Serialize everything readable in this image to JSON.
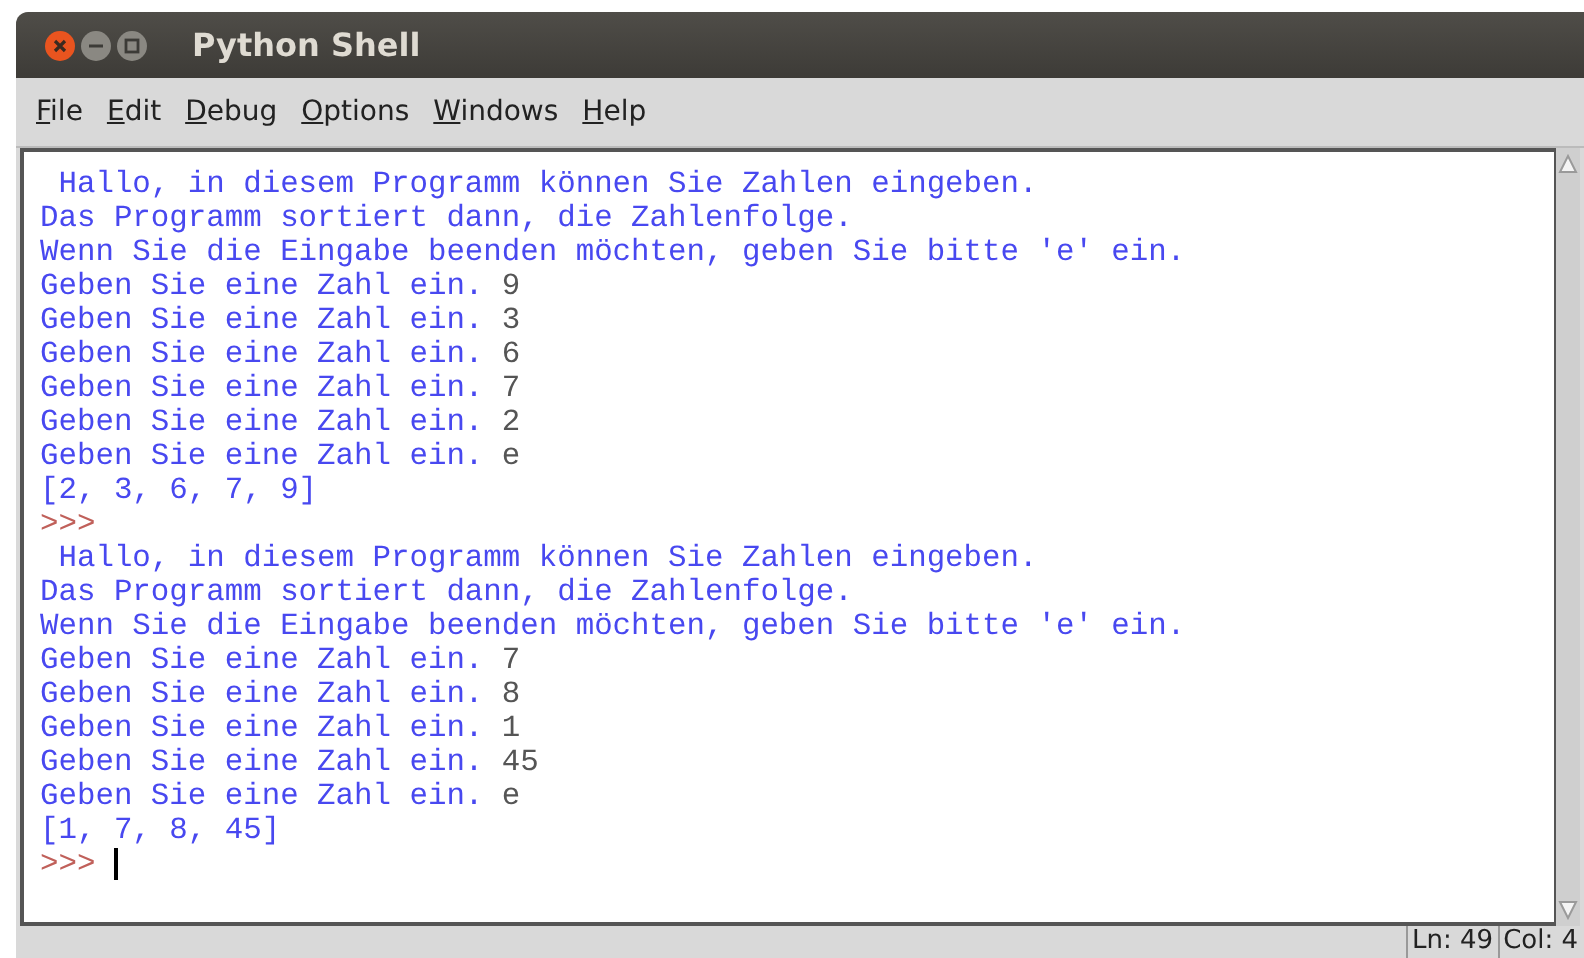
{
  "window": {
    "title": "Python Shell"
  },
  "menu": [
    {
      "label": "File"
    },
    {
      "label": "Edit"
    },
    {
      "label": "Debug"
    },
    {
      "label": "Options"
    },
    {
      "label": "Windows"
    },
    {
      "label": "Help"
    }
  ],
  "shell_lines": [
    {
      "kind": "output",
      "text": " Hallo, in diesem Programm können Sie Zahlen eingeben."
    },
    {
      "kind": "output",
      "text": "Das Programm sortiert dann, die Zahlenfolge."
    },
    {
      "kind": "output",
      "text": "Wenn Sie die Eingabe beenden möchten, geben Sie bitte 'e' ein."
    },
    {
      "kind": "input",
      "prompt": "Geben Sie eine Zahl ein.",
      "value": "9"
    },
    {
      "kind": "input",
      "prompt": "Geben Sie eine Zahl ein.",
      "value": "3"
    },
    {
      "kind": "input",
      "prompt": "Geben Sie eine Zahl ein.",
      "value": "6"
    },
    {
      "kind": "input",
      "prompt": "Geben Sie eine Zahl ein.",
      "value": "7"
    },
    {
      "kind": "input",
      "prompt": "Geben Sie eine Zahl ein.",
      "value": "2"
    },
    {
      "kind": "input",
      "prompt": "Geben Sie eine Zahl ein.",
      "value": "e"
    },
    {
      "kind": "output",
      "text": "[2, 3, 6, 7, 9]"
    },
    {
      "kind": "prompt",
      "text": ">>>",
      "cursor": false
    },
    {
      "kind": "output",
      "text": " Hallo, in diesem Programm können Sie Zahlen eingeben."
    },
    {
      "kind": "output",
      "text": "Das Programm sortiert dann, die Zahlenfolge."
    },
    {
      "kind": "output",
      "text": "Wenn Sie die Eingabe beenden möchten, geben Sie bitte 'e' ein."
    },
    {
      "kind": "input",
      "prompt": "Geben Sie eine Zahl ein.",
      "value": "7"
    },
    {
      "kind": "input",
      "prompt": "Geben Sie eine Zahl ein.",
      "value": "8"
    },
    {
      "kind": "input",
      "prompt": "Geben Sie eine Zahl ein.",
      "value": "1"
    },
    {
      "kind": "input",
      "prompt": "Geben Sie eine Zahl ein.",
      "value": "45"
    },
    {
      "kind": "input",
      "prompt": "Geben Sie eine Zahl ein.",
      "value": "e"
    },
    {
      "kind": "output",
      "text": "[1, 7, 8, 45]"
    },
    {
      "kind": "prompt",
      "text": ">>>",
      "cursor": true
    }
  ],
  "status_bar": {
    "line": "Ln: 49",
    "column": "Col: 4"
  }
}
